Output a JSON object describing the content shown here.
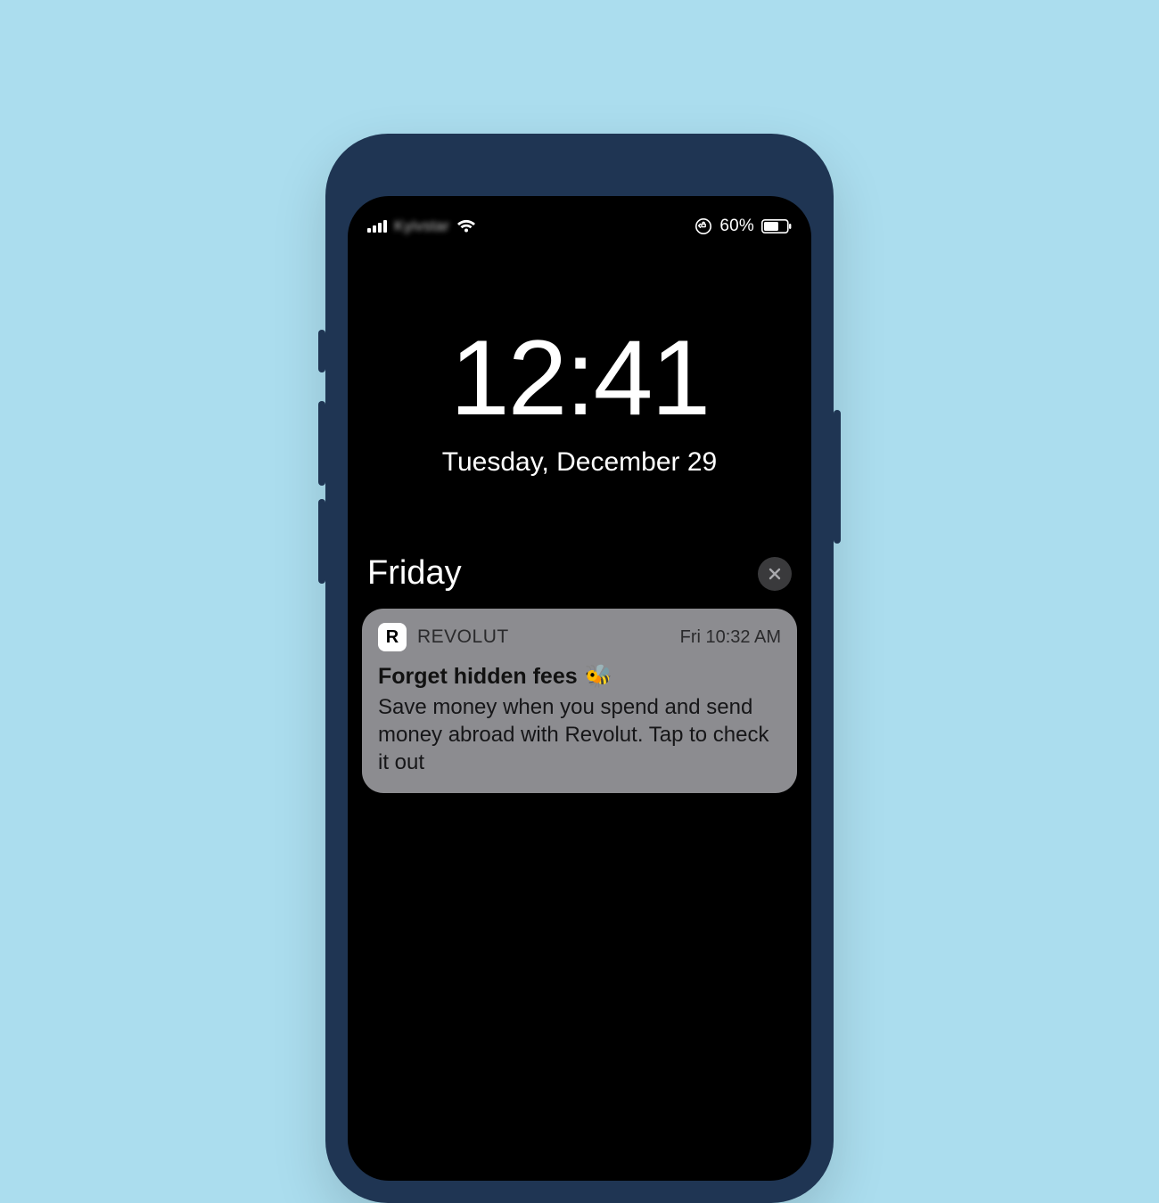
{
  "status": {
    "carrier": "Kyivstar",
    "battery_pct": "60%"
  },
  "lock": {
    "time": "12:41",
    "date": "Tuesday, December 29"
  },
  "group": {
    "label": "Friday"
  },
  "notification": {
    "app_letter": "R",
    "app_name": "REVOLUT",
    "time": "Fri 10:32 AM",
    "title": "Forget hidden fees",
    "emoji": "🐝",
    "body": "Save money when you spend and send money abroad with Revolut. Tap to check it out"
  }
}
